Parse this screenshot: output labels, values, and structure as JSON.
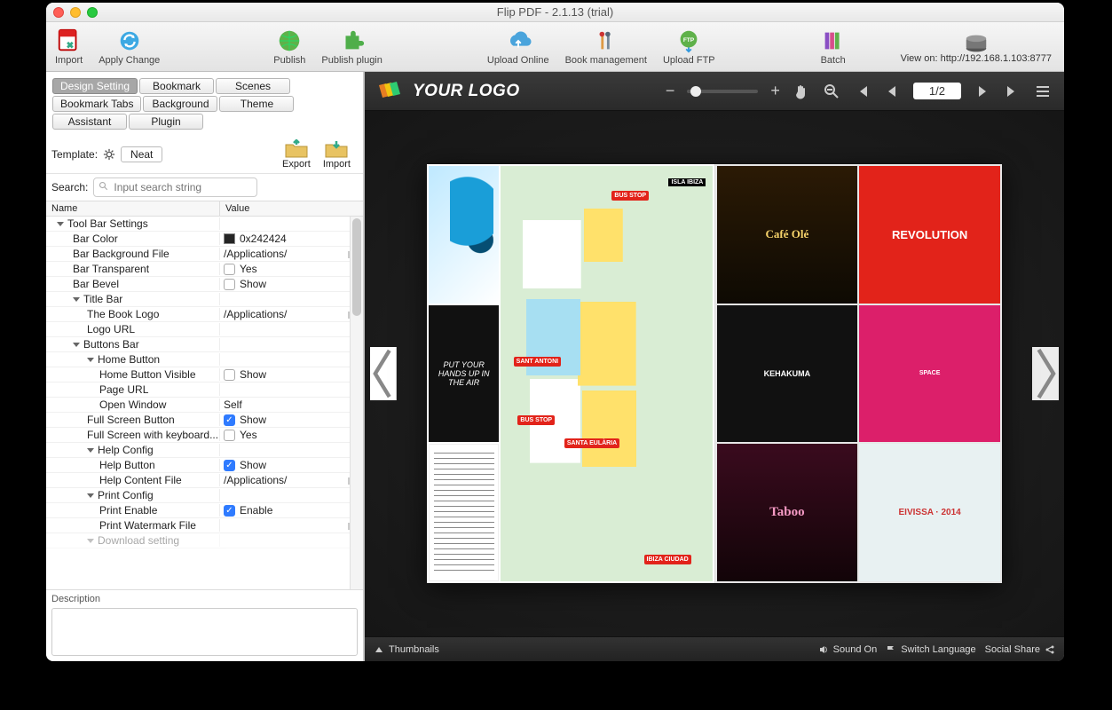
{
  "window": {
    "title": "Flip PDF - 2.1.13 (trial)"
  },
  "toolbar": {
    "import": "Import",
    "apply_change": "Apply Change",
    "publish": "Publish",
    "publish_plugin": "Publish plugin",
    "upload_online": "Upload Online",
    "book_management": "Book management",
    "upload_ftp": "Upload FTP",
    "batch": "Batch",
    "view_on": "View on: http://192.168.1.103:8777"
  },
  "tabs": {
    "design_setting": "Design Setting",
    "bookmark": "Bookmark",
    "scenes": "Scenes",
    "bookmark_tabs": "Bookmark Tabs",
    "background": "Background",
    "theme": "Theme",
    "assistant": "Assistant",
    "plugin": "Plugin"
  },
  "template": {
    "label": "Template:",
    "name": "Neat",
    "export": "Export",
    "import": "Import"
  },
  "search": {
    "label": "Search:",
    "placeholder": "Input search string"
  },
  "columns": {
    "name": "Name",
    "value": "Value"
  },
  "props": {
    "tool_bar_settings": "Tool Bar Settings",
    "bar_color": "Bar Color",
    "bar_color_val": "0x242424",
    "bar_bg_file": "Bar Background File",
    "bar_bg_file_val": "/Applications/",
    "bar_transparent": "Bar Transparent",
    "bar_transparent_val": "Yes",
    "bar_bevel": "Bar Bevel",
    "bar_bevel_val": "Show",
    "title_bar": "Title Bar",
    "book_logo": "The Book Logo",
    "book_logo_val": "/Applications/",
    "logo_url": "Logo URL",
    "buttons_bar": "Buttons Bar",
    "home_button": "Home Button",
    "home_button_visible": "Home Button Visible",
    "home_button_visible_val": "Show",
    "page_url": "Page URL",
    "open_window": "Open Window",
    "open_window_val": "Self",
    "full_screen_button": "Full Screen Button",
    "full_screen_button_val": "Show",
    "full_screen_kb": "Full Screen with keyboard...",
    "full_screen_kb_val": "Yes",
    "help_config": "Help Config",
    "help_button": "Help Button",
    "help_button_val": "Show",
    "help_content_file": "Help Content File",
    "help_content_file_val": "/Applications/",
    "print_config": "Print Config",
    "print_enable": "Print Enable",
    "print_enable_val": "Enable",
    "print_watermark": "Print Watermark File",
    "download_setting": "Download setting"
  },
  "desc": {
    "label": "Description"
  },
  "preview": {
    "logo_text": "YOUR LOGO",
    "page_indicator": "1/2",
    "thumbnails": "Thumbnails",
    "sound_on": "Sound On",
    "switch_language": "Switch Language",
    "social_share": "Social Share",
    "hands_up": "PUT YOUR HANDS UP IN THE AIR",
    "p1": "Café Olé",
    "p2": "REVOLUTION",
    "p4": "SPACE",
    "p5": "Taboo",
    "p6": "EIVISSA · 2014"
  }
}
